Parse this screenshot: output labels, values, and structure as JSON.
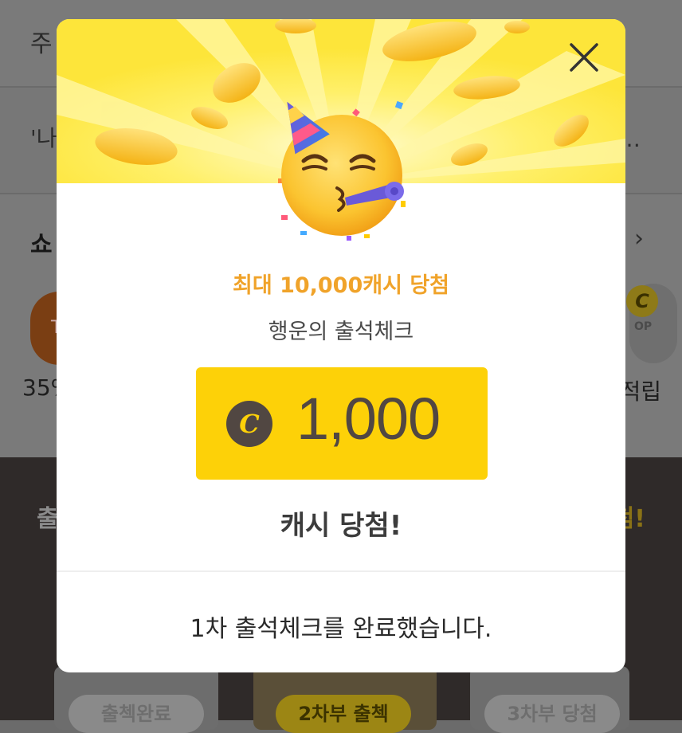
{
  "background": {
    "top_text": "주",
    "row2_left": "'나",
    "row2_right": "…",
    "shop_title": "쇼",
    "left_thumb_text": "TI",
    "right_thumb_coin": "C",
    "right_thumb_text": "OP",
    "left_percent": "35%",
    "right_label": "적립",
    "dark_left": "출",
    "dark_right": "첨!",
    "cards": [
      "출첵완료",
      "2차부 출첵",
      "3차부 당첨"
    ]
  },
  "modal": {
    "prize_subtitle": "최대 10,000캐시 당첨",
    "event_title": "행운의 출석체크",
    "coin_symbol": "C",
    "amount": "1,000",
    "won_text": "캐시 당첨!",
    "footer_message": "1차 출석체크를 완료했습니다.",
    "close_label": "✕"
  },
  "colors": {
    "hero_yellow": "#fde53a",
    "amount_box": "#fdd108",
    "subtitle_orange": "#f0a32a",
    "amount_text": "#514742"
  },
  "icons": [
    "close-icon",
    "party-face-emoji",
    "coin-icon",
    "chevron-right-icon"
  ]
}
